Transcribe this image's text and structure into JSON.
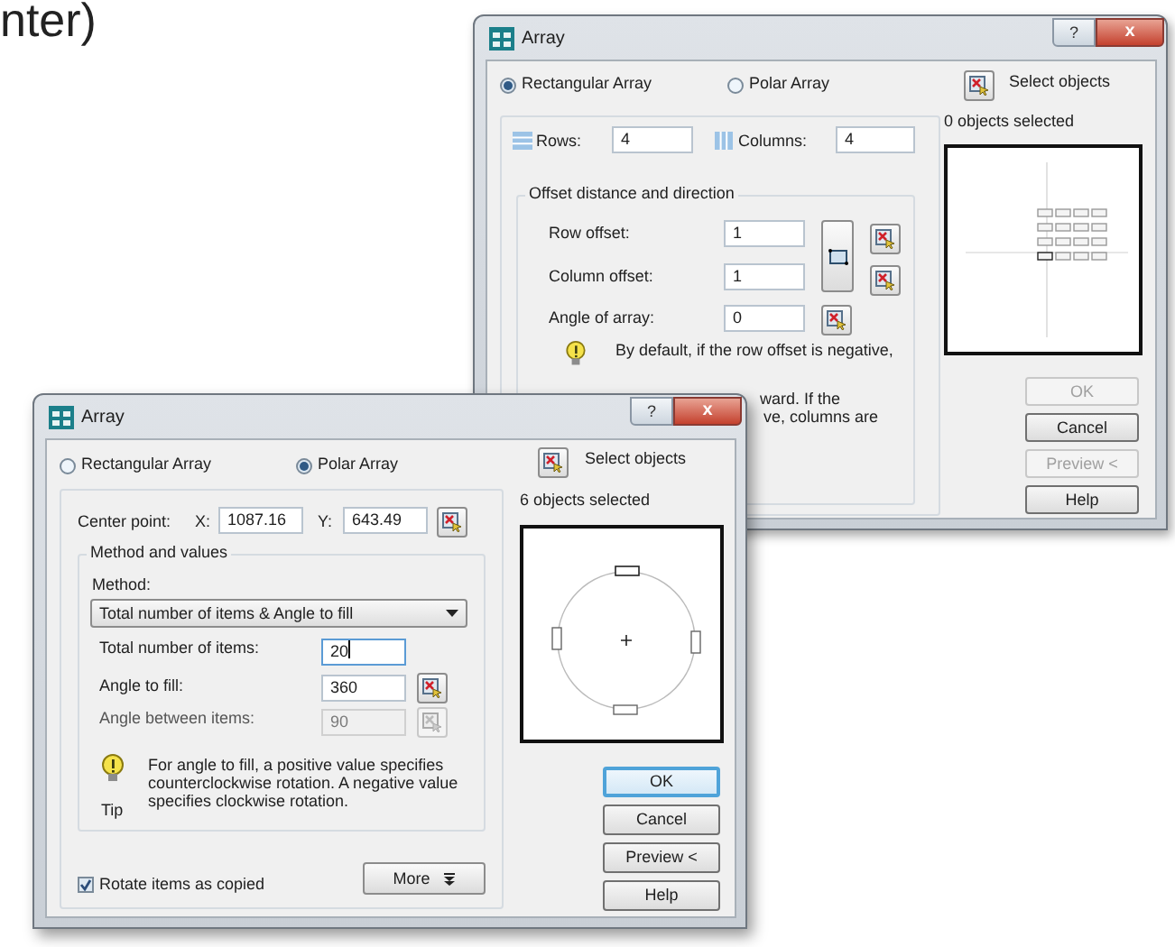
{
  "page_text": "nter)",
  "rectangular_dialog": {
    "title": "Array",
    "help_button": "?",
    "close_button": "x",
    "radios": [
      {
        "label": "Rectangular Array",
        "selected": true
      },
      {
        "label": "Polar Array",
        "selected": false
      }
    ],
    "select_objects": "Select objects",
    "selection_count": "0 objects selected",
    "rows": {
      "label": "Rows:",
      "value": "4"
    },
    "columns": {
      "label": "Columns:",
      "value": "4"
    },
    "offset_group": {
      "title": "Offset distance and direction",
      "fields": [
        {
          "label": "Row offset:",
          "value": "1"
        },
        {
          "label": "Column offset:",
          "value": "1"
        },
        {
          "label": "Angle of array:",
          "value": "0"
        }
      ]
    },
    "tip_lines": [
      "By default, if the row offset is negative,",
      "ward.  If the",
      "ve, columns are"
    ],
    "buttons": [
      {
        "label": "OK",
        "disabled": true
      },
      {
        "label": "Cancel",
        "disabled": false
      },
      {
        "label": "Preview <",
        "disabled": true
      },
      {
        "label": "Help",
        "disabled": false
      }
    ]
  },
  "polar_dialog": {
    "title": "Array",
    "help_button": "?",
    "close_button": "x",
    "radios": [
      {
        "label": "Rectangular Array",
        "selected": false
      },
      {
        "label": "Polar Array",
        "selected": true
      }
    ],
    "select_objects": "Select objects",
    "selection_count": "6 objects selected",
    "center_point": {
      "label": "Center point:",
      "x_label": "X:",
      "x_value": "1087.16",
      "y_label": "Y:",
      "y_value": "643.49"
    },
    "method_group": {
      "title": "Method and values",
      "method_label": "Method:",
      "method_value": "Total number of items & Angle to fill",
      "fields": [
        {
          "label": "Total number of items:",
          "value": "20",
          "disabled": false,
          "focused": true,
          "pick_button": false
        },
        {
          "label": "Angle to fill:",
          "value": "360",
          "disabled": false,
          "focused": false,
          "pick_button": true
        },
        {
          "label": "Angle between items:",
          "value": "90",
          "disabled": true,
          "focused": false,
          "pick_button": true
        }
      ]
    },
    "tip": {
      "label": "Tip",
      "text": "For angle to fill, a positive value specifies counterclockwise rotation.  A negative value specifies clockwise rotation."
    },
    "rotate_items": {
      "label": "Rotate items as copied",
      "checked": true
    },
    "more_button": "More",
    "buttons": [
      {
        "label": "OK",
        "default": true
      },
      {
        "label": "Cancel",
        "default": false
      },
      {
        "label": "Preview <",
        "default": false
      },
      {
        "label": "Help",
        "default": false
      }
    ]
  }
}
